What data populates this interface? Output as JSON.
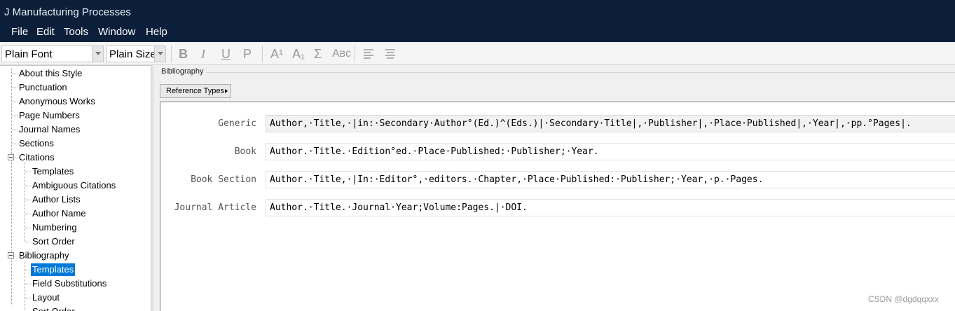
{
  "window": {
    "title": "J Manufacturing Processes"
  },
  "menu": [
    "File",
    "Edit",
    "Tools",
    "Window",
    "Help"
  ],
  "toolbar": {
    "font_value": "Plain Font",
    "size_value": "Plain Size",
    "bold": "B",
    "italic": "I",
    "underline": "U",
    "plain": "P",
    "superscript": "A¹",
    "subscript": "A₁",
    "symbol": "Σ",
    "smallcaps": "Aʙᴄ"
  },
  "tree": {
    "about": "About this Style",
    "punctuation": "Punctuation",
    "anonymous": "Anonymous Works",
    "pagenumbers": "Page Numbers",
    "journalnames": "Journal Names",
    "sections": "Sections",
    "citations": "Citations",
    "cit_templates": "Templates",
    "cit_ambiguous": "Ambiguous Citations",
    "cit_authorlists": "Author Lists",
    "cit_authorname": "Author Name",
    "cit_numbering": "Numbering",
    "cit_sortorder": "Sort Order",
    "bibliography": "Bibliography",
    "bib_templates": "Templates",
    "bib_fieldsubs": "Field Substitutions",
    "bib_layout": "Layout",
    "bib_sortorder": "Sort Order"
  },
  "main": {
    "group_label": "Bibliography",
    "reference_types_button": "Reference Types",
    "rows": [
      {
        "label": "Generic",
        "template": "Author,·Title,·|in:·Secondary·Author°(Ed.)^(Eds.)|·Secondary·Title|,·Publisher|,·Place·Published|,·Year|,·pp.°Pages|."
      },
      {
        "label": "Book",
        "template": "Author.·Title.·Edition°ed.·Place·Published:·Publisher;·Year."
      },
      {
        "label": "Book Section",
        "template": "Author.·Title,·|In:·Editor°,·editors.·Chapter,·Place·Published:·Publisher;·Year,·p.·Pages."
      },
      {
        "label": "Journal Article",
        "template": "Author.·Title.·Journal·Year;Volume:Pages.|·DOI."
      }
    ]
  },
  "watermark": "CSDN @dgdqqxxx"
}
